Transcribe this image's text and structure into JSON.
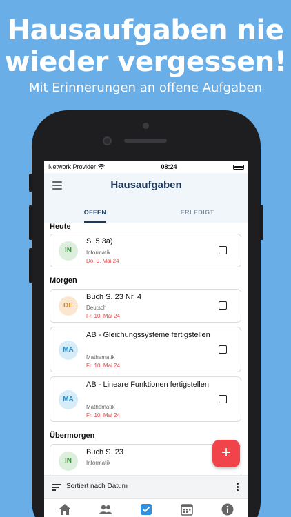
{
  "promo": {
    "headline_line1": "Hausaufgaben nie",
    "headline_line2": "wieder vergessen!",
    "subline": "Mit Erinnerungen an offene Aufgaben"
  },
  "status_bar": {
    "carrier": "Network Provider",
    "time": "08:24"
  },
  "app_bar": {
    "title": "Hausaufgaben",
    "tabs": [
      {
        "label": "OFFEN",
        "active": true
      },
      {
        "label": "ERLEDIGT",
        "active": false
      }
    ]
  },
  "sections": [
    {
      "title": "Heute",
      "items": [
        {
          "badge": "IN",
          "title": "S. 5 3a)",
          "subject": "Informatik",
          "due": "Do. 9. Mai 24",
          "checked": false
        }
      ]
    },
    {
      "title": "Morgen",
      "items": [
        {
          "badge": "DE",
          "title": "Buch S. 23 Nr. 4",
          "subject": "Deutsch",
          "due": "Fr. 10. Mai 24",
          "checked": false
        },
        {
          "badge": "MA",
          "title": "AB - Gleichungssysteme fertigstellen",
          "subject": "Mathematik",
          "due": "Fr. 10. Mai 24",
          "checked": false
        },
        {
          "badge": "MA",
          "title": "AB - Lineare Funktionen fertigstellen",
          "subject": "Mathematik",
          "due": "Fr. 10. Mai 24",
          "checked": false
        }
      ]
    },
    {
      "title": "Übermorgen",
      "items": [
        {
          "badge": "IN",
          "title": "Buch S. 23",
          "subject": "Informatik",
          "due": "",
          "checked": false
        }
      ]
    }
  ],
  "fab": {
    "label": "+"
  },
  "sort_bar": {
    "label": "Sortiert nach Datum"
  },
  "bottom_nav": [
    "home-icon",
    "people-icon",
    "tasks-check-icon",
    "calendar-icon",
    "info-icon"
  ],
  "colors": {
    "background": "#6aaee8",
    "accent_red": "#f0434a",
    "title_navy": "#1e3a5a",
    "due_red": "#e24b4b",
    "active_nav": "#2f8fe0"
  }
}
